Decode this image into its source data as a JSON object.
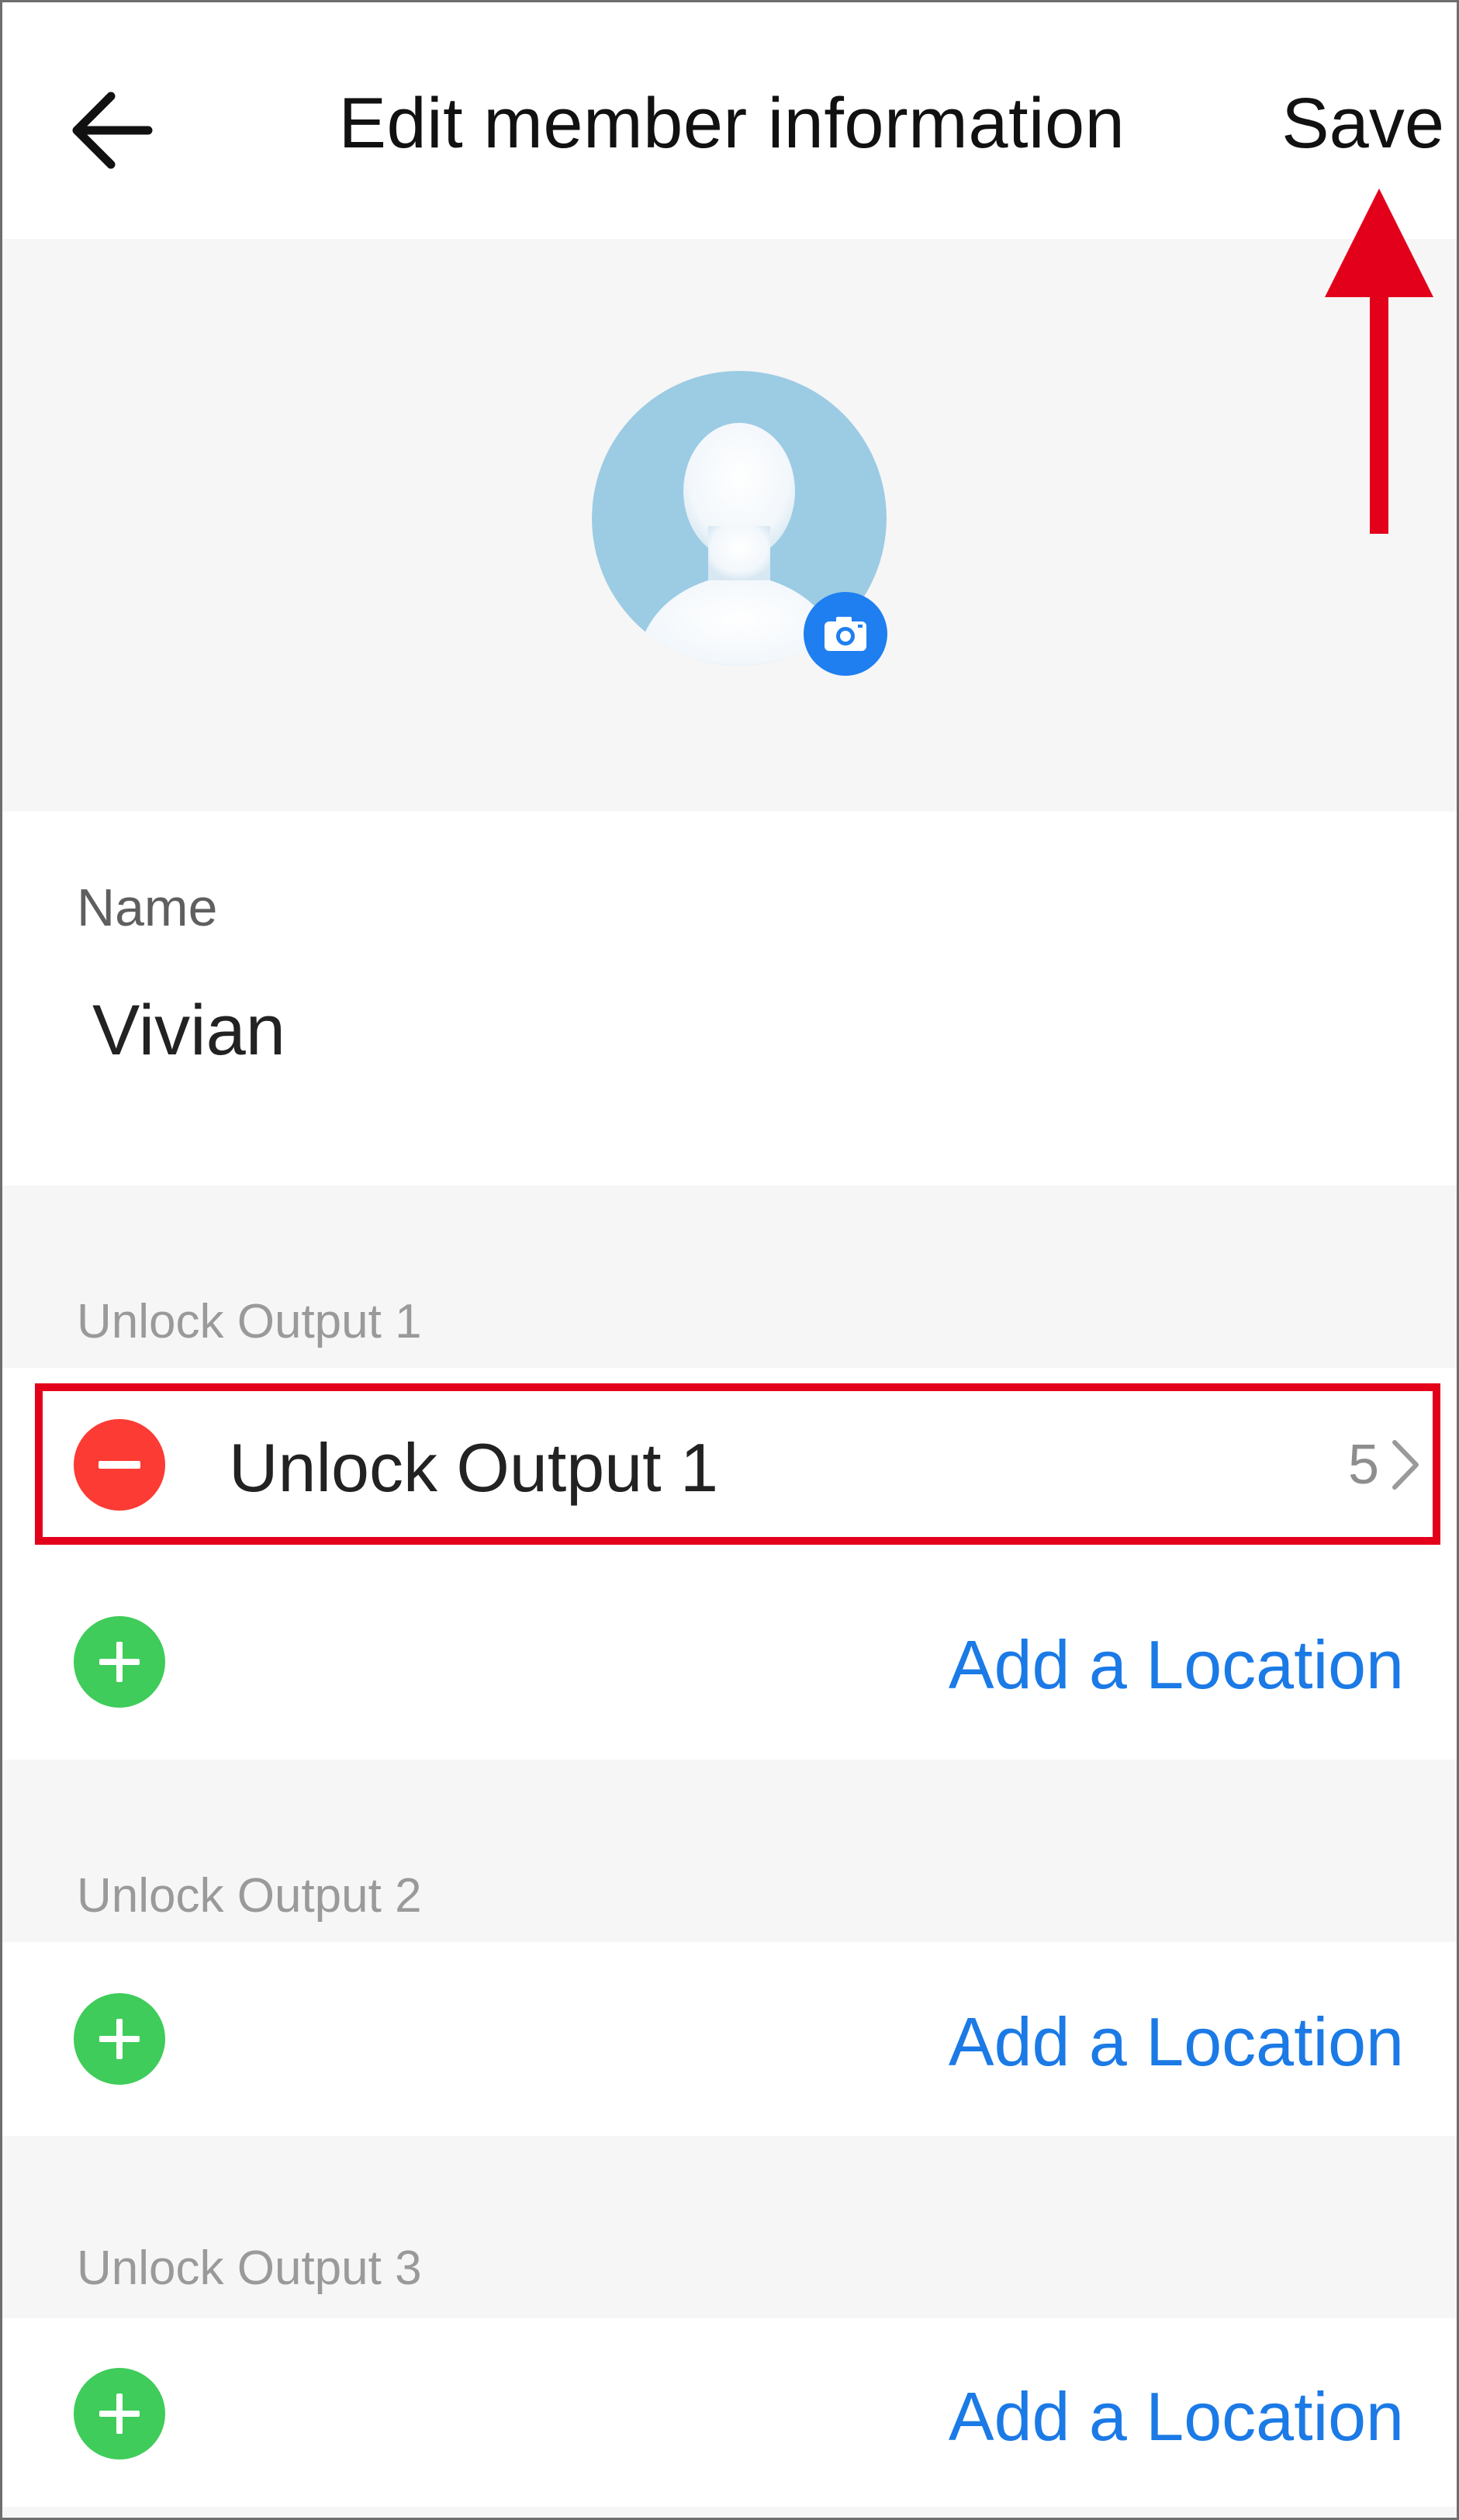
{
  "header": {
    "title": "Edit member information",
    "save_label": "Save"
  },
  "name_section": {
    "label": "Name",
    "value": "Vivian"
  },
  "groups": [
    {
      "label": "Unlock Output 1",
      "entries": [
        {
          "name": "Unlock Output 1",
          "count": "5"
        }
      ],
      "add_label": "Add a Location"
    },
    {
      "label": "Unlock Output 2",
      "add_label": "Add a Location"
    },
    {
      "label": "Unlock Output 3",
      "add_label": "Add a Location"
    }
  ],
  "colors": {
    "accent_blue": "#1b7ae6",
    "camera_badge": "#1f7ff0",
    "remove_red": "#fb3b34",
    "add_green": "#3fcc5a",
    "annotation_red": "#e3001b",
    "section_gray": "#f6f6f6"
  },
  "icons": {
    "back": "arrow-left-icon",
    "avatar": "default-user-avatar-icon",
    "camera": "camera-icon",
    "remove": "minus-circle-icon",
    "add": "plus-circle-icon",
    "chevron": "chevron-right-icon"
  }
}
